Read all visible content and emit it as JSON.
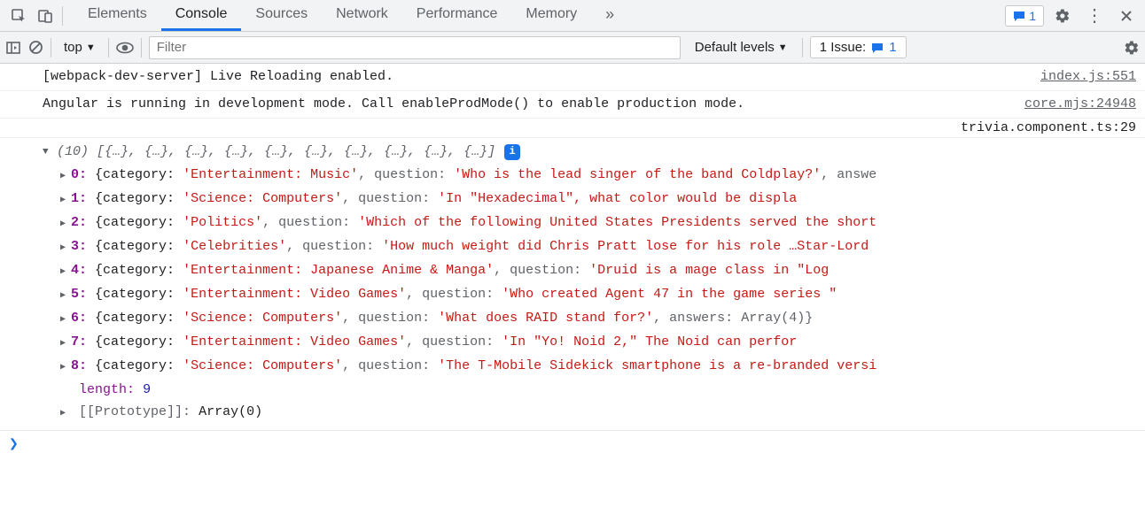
{
  "tabs": [
    "Elements",
    "Console",
    "Sources",
    "Network",
    "Performance",
    "Memory"
  ],
  "activeTab": "Console",
  "msgBadgeCount": "1",
  "contextSelector": "top",
  "filterPlaceholder": "Filter",
  "levelsLabel": "Default levels",
  "issuesLabel": "1 Issue:",
  "issuesCount": "1",
  "logs": [
    {
      "text": "[webpack-dev-server] Live Reloading enabled.",
      "src": "index.js:551"
    },
    {
      "text": "Angular is running in development mode. Call enableProdMode() to enable production mode.",
      "src": "core.mjs:24948"
    }
  ],
  "objSource": "trivia.component.ts:29",
  "arraySummary": "(10) [{…}, {…}, {…}, {…}, {…}, {…}, {…}, {…}, {…}, {…}]",
  "entries": [
    {
      "idx": "0",
      "category": "'Entertainment: Music'",
      "questionKey": "question:",
      "question": "'Who is the lead singer of the band Coldplay?'",
      "tail": ", answe"
    },
    {
      "idx": "1",
      "category": "'Science: Computers'",
      "questionKey": "question:",
      "question": "'In &quot;Hexadecimal&quot;, what color would be displa",
      "tail": ""
    },
    {
      "idx": "2",
      "category": "'Politics'",
      "questionKey": "question:",
      "question": "'Which of the following United States Presidents served the short",
      "tail": ""
    },
    {
      "idx": "3",
      "category": "'Celebrities'",
      "questionKey": "question:",
      "question": "'How much weight did Chris Pratt lose for his role …Star-Lord",
      "tail": ""
    },
    {
      "idx": "4",
      "category": "'Entertainment: Japanese Anime & Manga'",
      "questionKey": "question:",
      "question": "'Druid is a mage class in &quot;Log",
      "tail": ""
    },
    {
      "idx": "5",
      "category": "'Entertainment: Video Games'",
      "questionKey": "question:",
      "question": "'Who created Agent 47 in the game series &quot;",
      "tail": ""
    },
    {
      "idx": "6",
      "category": "'Science: Computers'",
      "questionKey": "question:",
      "question": "'What does RAID stand for?'",
      "tail": ", answers: Array(4)}"
    },
    {
      "idx": "7",
      "category": "'Entertainment: Video Games'",
      "questionKey": "question:",
      "question": "'In &quot;Yo! Noid 2,&quot; The Noid can perfor",
      "tail": ""
    },
    {
      "idx": "8",
      "category": "'Science: Computers'",
      "questionKey": "question:",
      "question": "'The T-Mobile Sidekick smartphone is a re-branded versi",
      "tail": ""
    }
  ],
  "lengthLabel": "length",
  "lengthValue": "9",
  "protoLabel": "[[Prototype]]",
  "protoValue": "Array(0)",
  "entryOpen": "{category: ",
  "categoryComma": ", "
}
